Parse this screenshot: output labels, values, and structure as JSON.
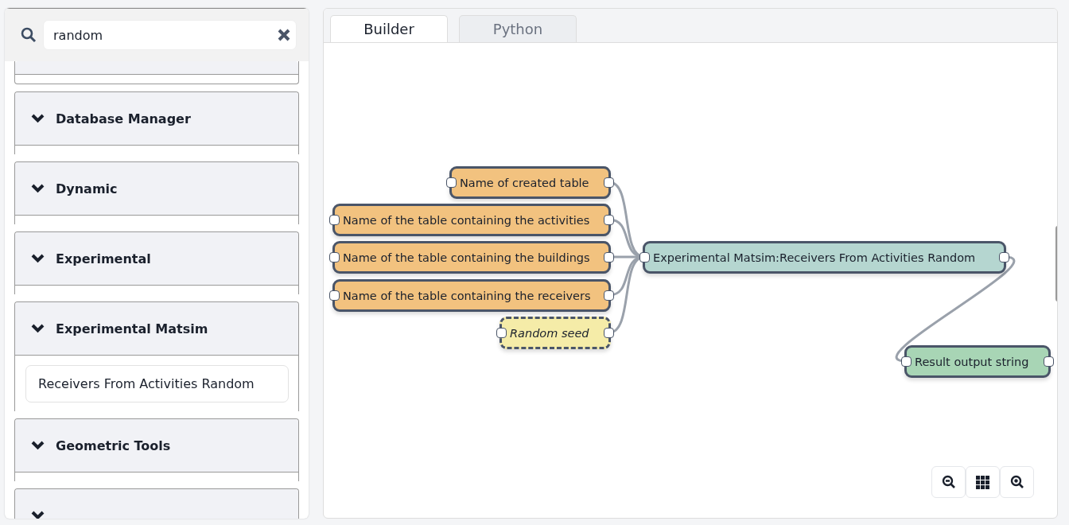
{
  "search": {
    "value": "random"
  },
  "categories": [
    {
      "title": "Database Manager",
      "expanded": true
    },
    {
      "title": "Dynamic",
      "expanded": true
    },
    {
      "title": "Experimental",
      "expanded": true
    },
    {
      "title": "Experimental Matsim",
      "expanded": true,
      "items": [
        "Receivers From Activities Random"
      ]
    },
    {
      "title": "Geometric Tools",
      "expanded": true
    },
    {
      "expanded": true
    }
  ],
  "tabs": [
    {
      "label": "Builder",
      "selected": true
    },
    {
      "label": "Python",
      "selected": false
    }
  ],
  "nodes": [
    {
      "kind": "input",
      "label": "Name of created table"
    },
    {
      "kind": "input",
      "label": "Name of the table containing the activities"
    },
    {
      "kind": "input",
      "label": "Name of the table containing the buildings"
    },
    {
      "kind": "input",
      "label": "Name of the table containing the receivers"
    },
    {
      "kind": "param",
      "label": "Random seed"
    },
    {
      "kind": "process",
      "label": "Experimental Matsim:Receivers From Activities Random"
    },
    {
      "kind": "output",
      "label": "Result output string"
    }
  ]
}
